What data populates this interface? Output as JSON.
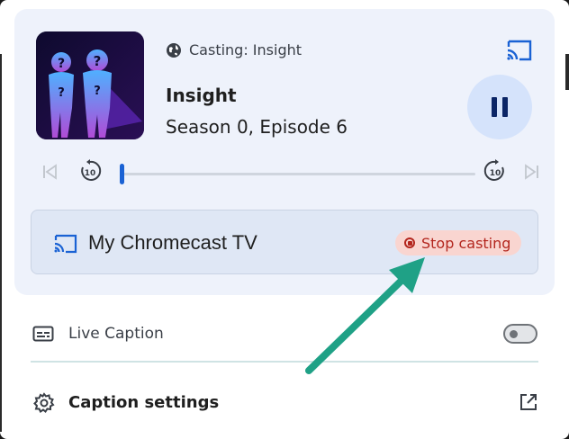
{
  "media": {
    "casting_label": "Casting: Insight",
    "title": "Insight",
    "episode": "Season 0, Episode 6",
    "is_playing": true,
    "progress_fraction": 0.01
  },
  "icons": {
    "globe": "globe-icon",
    "cast": "cast-icon",
    "pause": "pause-icon",
    "previous": "skip-previous-icon",
    "replay10": "replay-10-icon",
    "forward10": "forward-10-icon",
    "next": "skip-next-icon",
    "stop": "stop-circle-icon",
    "caption": "closed-caption-icon",
    "gear": "gear-icon",
    "open": "open-in-new-icon"
  },
  "seek": {
    "replay_seconds": "10",
    "forward_seconds": "10"
  },
  "device": {
    "name": "My Chromecast TV",
    "stop_label": "Stop casting"
  },
  "live_caption": {
    "label": "Live Caption",
    "enabled": false
  },
  "caption_settings": {
    "label": "Caption settings"
  },
  "colors": {
    "accent": "#1a62d4",
    "stop_red": "#b3261e",
    "stop_bg": "#f9d5d0",
    "card_bg": "#eef2fb",
    "annotation_arrow": "#1fa186"
  }
}
